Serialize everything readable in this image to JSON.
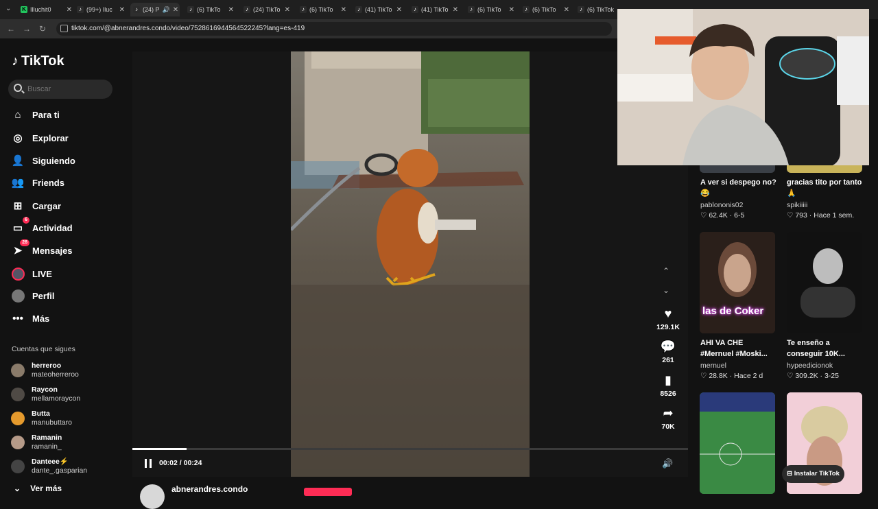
{
  "browser": {
    "tabs": [
      {
        "label": "Illuchit0",
        "icon": "K"
      },
      {
        "label": "(99+) Iluc",
        "icon": "tiktok-icon"
      },
      {
        "label": "(24) P",
        "icon": "tiktok-icon"
      },
      {
        "label": "(6) TikTo",
        "icon": "tiktok-icon"
      },
      {
        "label": "(24) TikTo",
        "icon": "tiktok-icon"
      },
      {
        "label": "(6) TikTo",
        "icon": "tiktok-icon"
      },
      {
        "label": "(41) TikTo",
        "icon": "tiktok-icon"
      },
      {
        "label": "(41) TikTo",
        "icon": "tiktok-icon"
      },
      {
        "label": "(6) TikTo",
        "icon": "tiktok-icon"
      },
      {
        "label": "(6) TikTo",
        "icon": "tiktok-icon"
      },
      {
        "label": "(6) TikTok",
        "icon": "tiktok-icon"
      }
    ],
    "url": "tiktok.com/@abnerandres.condo/video/7528616944564522245?lang=es-419"
  },
  "sidebar": {
    "logo": "TikTok",
    "search_placeholder": "Buscar",
    "nav": [
      {
        "label": "Para ti",
        "icon": "home-icon"
      },
      {
        "label": "Explorar",
        "icon": "compass-icon"
      },
      {
        "label": "Siguiendo",
        "icon": "following-icon"
      },
      {
        "label": "Friends",
        "icon": "friends-icon"
      },
      {
        "label": "Cargar",
        "icon": "upload-icon"
      },
      {
        "label": "Actividad",
        "icon": "activity-icon",
        "badge": "6"
      },
      {
        "label": "Mensajes",
        "icon": "messages-icon",
        "badge": "28"
      },
      {
        "label": "LIVE",
        "icon": "live-icon"
      },
      {
        "label": "Perfil",
        "icon": "profile-icon"
      },
      {
        "label": "Más",
        "icon": "more-icon"
      }
    ],
    "following_title": "Cuentas que sigues",
    "following": [
      {
        "name": "herreroo",
        "handle": "mateoherreroo"
      },
      {
        "name": "Raycon",
        "handle": "mellamoraycon"
      },
      {
        "name": "Butta",
        "handle": "manubuttaro"
      },
      {
        "name": "Ramanin",
        "handle": "ramanin_"
      },
      {
        "name": "Danteee⚡",
        "handle": "dante_.gasparian"
      }
    ],
    "see_more": "Ver más"
  },
  "player": {
    "progress": 0.098,
    "time": "00:02 / 00:24",
    "likes": "129.1K",
    "comments": "261",
    "saves": "8526",
    "shares": "70K",
    "author": "abnerandres.condo"
  },
  "recommendations": [
    {
      "caption": "A ver si despego no? 😂",
      "author": "pablononis02",
      "likes": "62.4K",
      "date": "6-5"
    },
    {
      "caption": "gracias tito por tanto 🙏",
      "author": "spikiiiii",
      "likes": "793",
      "date": "Hace 1 sem."
    },
    {
      "caption": "AHI VA CHE #Mernuel #Moski...",
      "author": "mernuel",
      "likes": "28.8K",
      "date": "Hace 2 d",
      "overlay": "las de Coker"
    },
    {
      "caption": "Te enseño a conseguir 10K...",
      "author": "hypeedicionok",
      "likes": "309.2K",
      "date": "3-25"
    }
  ],
  "install_button": "Instalar TikTok",
  "colors": {
    "accent": "#fe2c55",
    "background": "#121212"
  }
}
